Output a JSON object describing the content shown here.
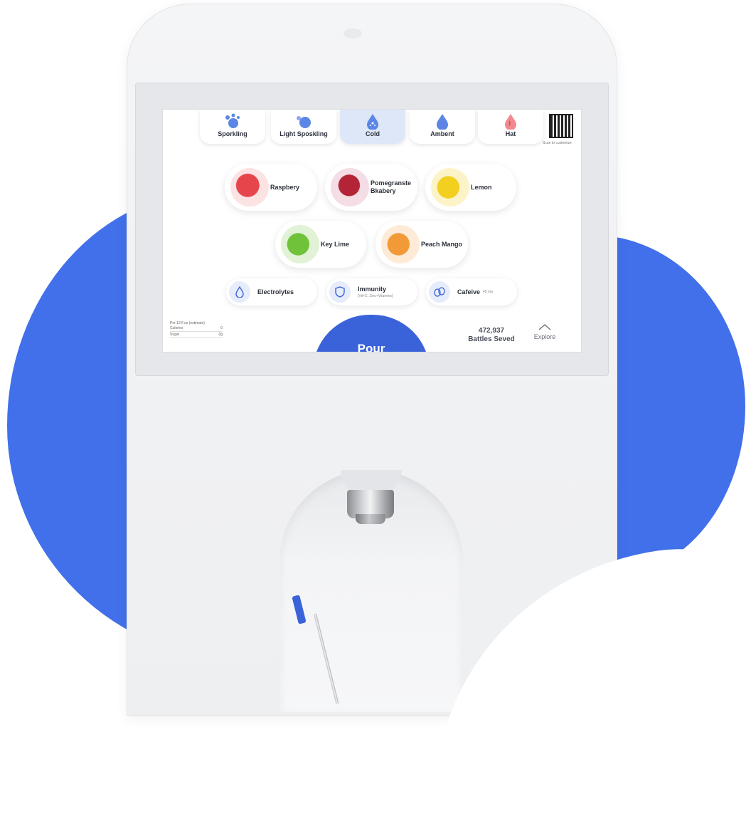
{
  "colors": {
    "accent": "#3b63d9",
    "blob": "#4270ea",
    "active_temp": "#dde7f8"
  },
  "temperatures": [
    {
      "label": "Sporkling",
      "icon": "bubbles-icon"
    },
    {
      "label": "Light Sposkling",
      "icon": "light-bubbles-icon"
    },
    {
      "label": "Cold",
      "icon": "cold-drop-icon",
      "active": true
    },
    {
      "label": "Ambent",
      "icon": "drop-icon"
    },
    {
      "label": "Hat",
      "icon": "hot-drop-icon"
    }
  ],
  "flavors": [
    {
      "label": "Raspbery",
      "color": "#d7262e"
    },
    {
      "label": "Pomegranste Bkabery",
      "line1": "Pomegranste",
      "line2": "Bkabery",
      "color": "#b32436"
    },
    {
      "label": "Lemon",
      "color": "#f3cf1f"
    },
    {
      "label": "Key Lime",
      "color": "#6fc23a"
    },
    {
      "label": "Peach Mango",
      "color": "#f29a38"
    }
  ],
  "boosts": [
    {
      "label": "Electrolytes",
      "icon": "electrolyte-drop-icon"
    },
    {
      "label": "Immunity",
      "sub": "[Vit+C, Zinc+Vitamins]",
      "icon": "shield-icon"
    },
    {
      "label": "Cafeive",
      "sub": "45 mg",
      "icon": "coffee-bean-icon"
    }
  ],
  "qr_caption": "Scan to customize",
  "nutrition": {
    "header": "Per 12 fl oz (estimate)",
    "rows": [
      {
        "label": "Calories",
        "value": "0"
      },
      {
        "label": "Sugar",
        "value": "0g"
      }
    ]
  },
  "pour_label": "Pour",
  "bottles": {
    "count": "472,937",
    "label": "Battles Seved"
  },
  "explore_label": "Explore"
}
